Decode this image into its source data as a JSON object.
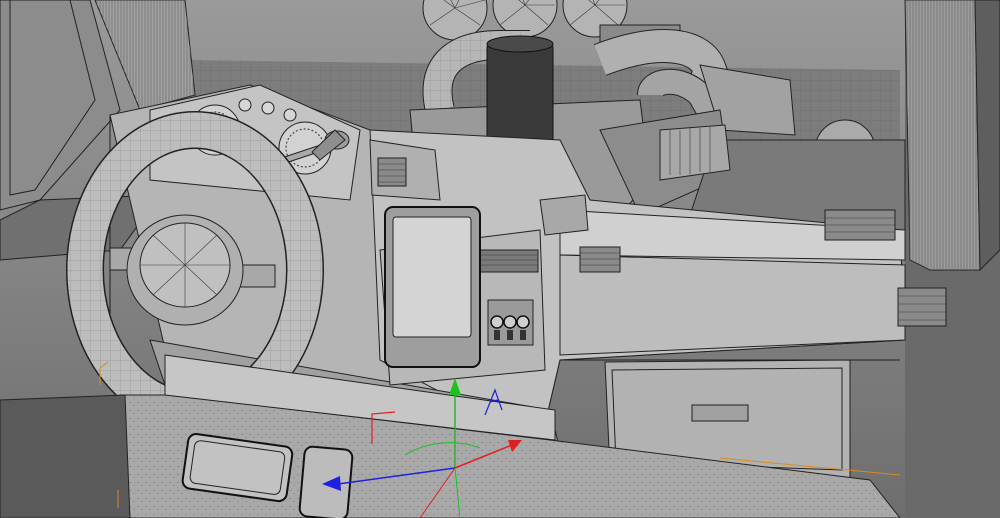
{
  "viewport": {
    "background": "#8a8a8a",
    "shading": "flat-gray-wireframe-on-shaded",
    "text_labels": []
  },
  "scene": {
    "objects": [
      "windshield-pillar-left",
      "windshield-pillar-right",
      "floor-grid",
      "engine-superchargers",
      "exhaust-pipes",
      "air-intake-cylinder",
      "instrument-cluster",
      "steering-wheel",
      "gear-lever",
      "dashboard",
      "tablet-display",
      "toggle-switches",
      "air-vents",
      "glovebox",
      "center-console",
      "console-buttons"
    ],
    "toggle_switch_count": 3,
    "gauge_count": 6
  },
  "gizmo": {
    "type": "move",
    "axes": [
      {
        "axis": "x",
        "color": "#e02020"
      },
      {
        "axis": "y",
        "color": "#20c020"
      },
      {
        "axis": "z",
        "color": "#2020e0"
      }
    ],
    "selection_color": "#d88a20"
  }
}
